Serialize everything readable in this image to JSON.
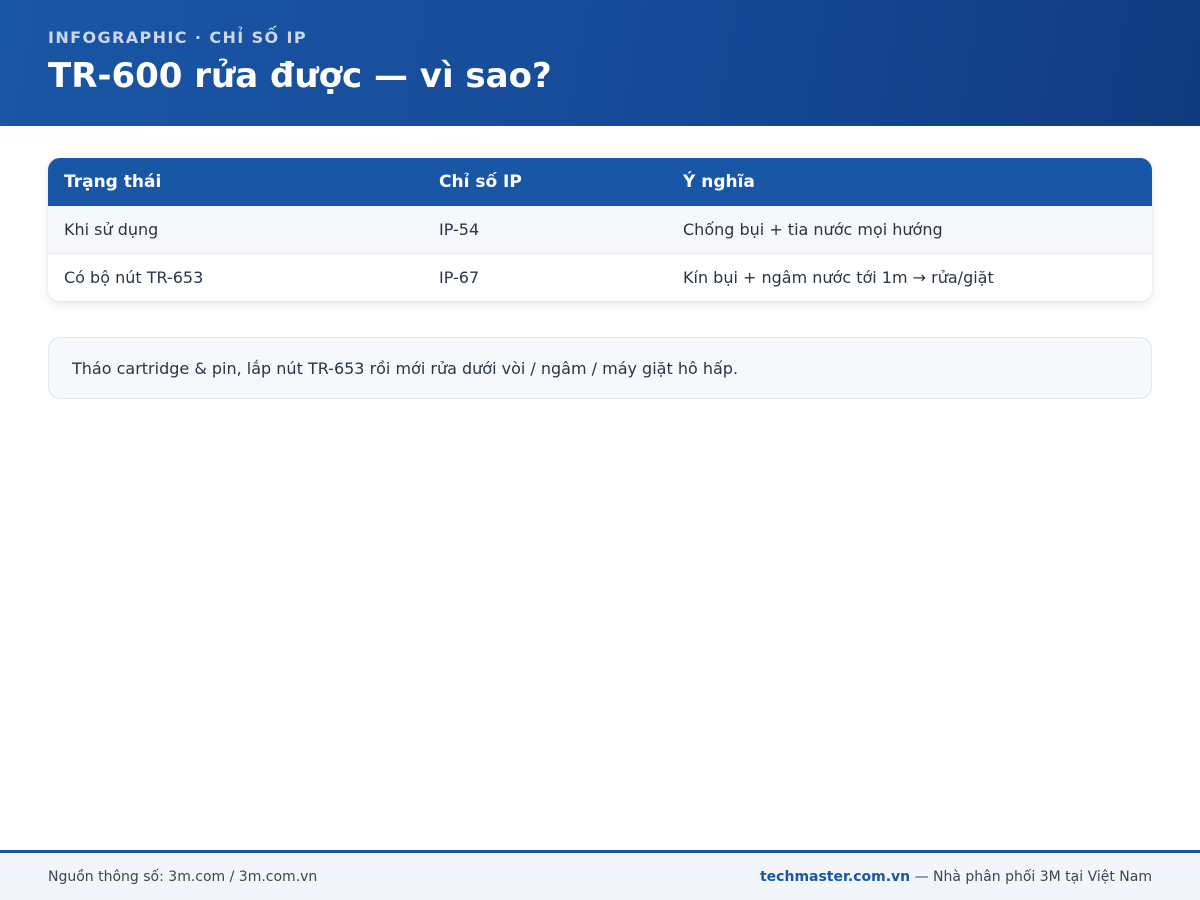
{
  "header": {
    "kicker": "INFOGRAPHIC · CHỈ SỐ IP",
    "title": "TR-600 rửa được — vì sao?"
  },
  "table": {
    "columns": [
      "Trạng thái",
      "Chỉ số IP",
      "Ý nghĩa"
    ],
    "rows": [
      [
        "Khi sử dụng",
        "IP-54",
        "Chống bụi + tia nước mọi hướng"
      ],
      [
        "Có bộ nút TR-653",
        "IP-67",
        "Kín bụi + ngâm nước tới 1m → rửa/giặt"
      ]
    ]
  },
  "note": {
    "text": "Tháo cartridge & pin, lắp nút TR-653 rồi mới rửa dưới vòi / ngâm / máy giặt hô hấp."
  },
  "footer": {
    "source": "Nguồn thông số: 3m.com / 3m.com.vn",
    "site": "techmaster.com.vn",
    "tagline": " — Nhà phân phối 3M tại Việt Nam"
  },
  "colors": {
    "brand_blue": "#1a56a6",
    "header_dark": "#103a80",
    "row_alt": "#f6f8fb"
  }
}
